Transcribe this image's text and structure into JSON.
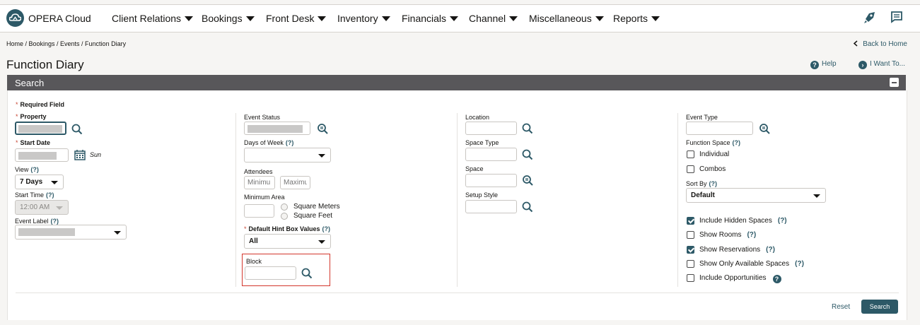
{
  "app": {
    "title": "OPERA Cloud"
  },
  "nav": {
    "items": [
      "Client Relations",
      "Bookings",
      "Front Desk",
      "Inventory",
      "Financials",
      "Channel",
      "Miscellaneous",
      "Reports"
    ]
  },
  "breadcrumb": "Home / Bookings / Events / Function Diary",
  "back_link": "Back to Home",
  "page_title": "Function Diary",
  "help_link": "Help",
  "iwant_link": "I Want To...",
  "panel_title": "Search",
  "required_note": "Required Field",
  "col1": {
    "property": "Property",
    "start_date": "Start Date",
    "start_day": "Sun",
    "view": "View",
    "view_value": "7 Days",
    "start_time": "Start Time",
    "start_time_value": "12:00 AM",
    "event_label": "Event Label"
  },
  "col2": {
    "event_status": "Event Status",
    "days_of_week": "Days of Week",
    "attendees": "Attendees",
    "attendees_min_placeholder": "Minimu",
    "attendees_max_placeholder": "Maximu",
    "minimum_area": "Minimum Area",
    "square_meters": "Square Meters",
    "square_feet": "Square Feet",
    "default_hint": "Default Hint Box Values",
    "default_hint_value": "All",
    "block": "Block"
  },
  "col3": {
    "location": "Location",
    "space_type": "Space Type",
    "space": "Space",
    "setup_style": "Setup Style"
  },
  "col4": {
    "event_type": "Event Type",
    "function_space": "Function Space",
    "individual": "Individual",
    "combos": "Combos",
    "sort_by": "Sort By",
    "sort_by_value": "Default",
    "include_hidden": "Include Hidden Spaces",
    "show_rooms": "Show Rooms",
    "show_reservations": "Show Reservations",
    "show_only_available": "Show Only Available Spaces",
    "include_opportunities": "Include Opportunities"
  },
  "help_marker": "(?)",
  "buttons": {
    "reset": "Reset",
    "search": "Search"
  },
  "colors": {
    "accent": "#2d5967",
    "header": "#58575a",
    "highlight": "#d3362c"
  }
}
